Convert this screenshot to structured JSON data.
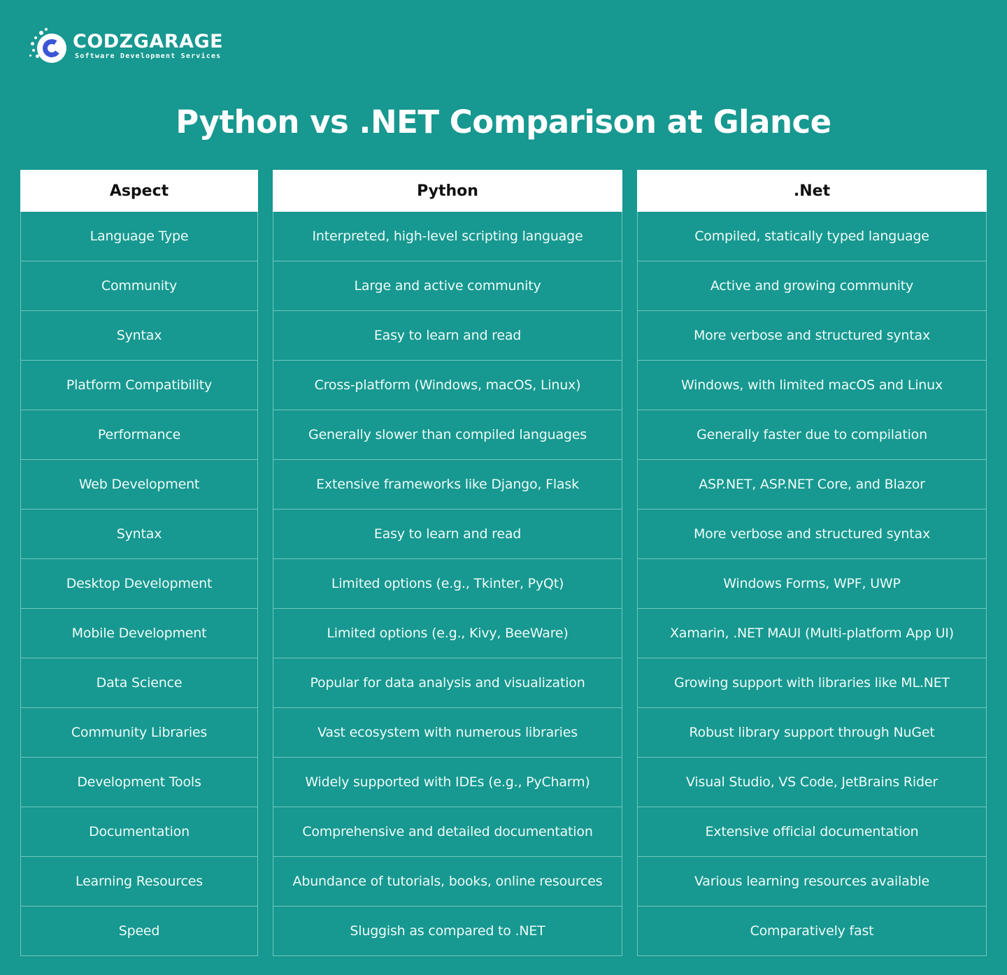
{
  "brand": {
    "name": "CODZGARAGE",
    "tagline": "Software Development Services",
    "colors": {
      "background": "#179890",
      "logo_c": "#3b56d6",
      "header_bg": "#ffffff",
      "cell_border": "#6fc9c0"
    }
  },
  "title": "Python vs .NET Comparison at Glance",
  "table": {
    "columns": [
      "Aspect",
      "Python",
      ".Net"
    ],
    "rows": [
      {
        "aspect": "Language Type",
        "python": "Interpreted, high-level scripting language",
        "net": "Compiled, statically typed language"
      },
      {
        "aspect": "Community",
        "python": "Large and active community",
        "net": "Active and growing community"
      },
      {
        "aspect": "Syntax",
        "python": "Easy to learn and read",
        "net": "More verbose and structured syntax"
      },
      {
        "aspect": "Platform Compatibility",
        "python": "Cross-platform (Windows, macOS, Linux)",
        "net": "Windows, with limited macOS and Linux"
      },
      {
        "aspect": "Performance",
        "python": "Generally slower than compiled languages",
        "net": "Generally faster due to compilation"
      },
      {
        "aspect": "Web Development",
        "python": "Extensive frameworks like Django, Flask",
        "net": "ASP.NET, ASP.NET Core, and Blazor"
      },
      {
        "aspect": "Syntax",
        "python": "Easy to learn and read",
        "net": "More verbose and structured syntax"
      },
      {
        "aspect": "Desktop Development",
        "python": "Limited options (e.g., Tkinter, PyQt)",
        "net": "Windows Forms, WPF, UWP"
      },
      {
        "aspect": "Mobile Development",
        "python": "Limited options (e.g., Kivy, BeeWare)",
        "net": "Xamarin, .NET MAUI (Multi-platform App UI)"
      },
      {
        "aspect": "Data Science",
        "python": "Popular for data analysis and visualization",
        "net": "Growing support with libraries like ML.NET"
      },
      {
        "aspect": "Community Libraries",
        "python": "Vast ecosystem with numerous libraries",
        "net": "Robust library support through NuGet"
      },
      {
        "aspect": "Development Tools",
        "python": "Widely supported with IDEs (e.g., PyCharm)",
        "net": "Visual Studio, VS Code, JetBrains Rider"
      },
      {
        "aspect": "Documentation",
        "python": "Comprehensive and detailed documentation",
        "net": "Extensive official documentation"
      },
      {
        "aspect": "Learning Resources",
        "python": "Abundance of tutorials, books, online resources",
        "net": "Various learning resources available"
      },
      {
        "aspect": "Speed",
        "python": "Sluggish as compared to .NET",
        "net": "Comparatively fast"
      }
    ]
  }
}
